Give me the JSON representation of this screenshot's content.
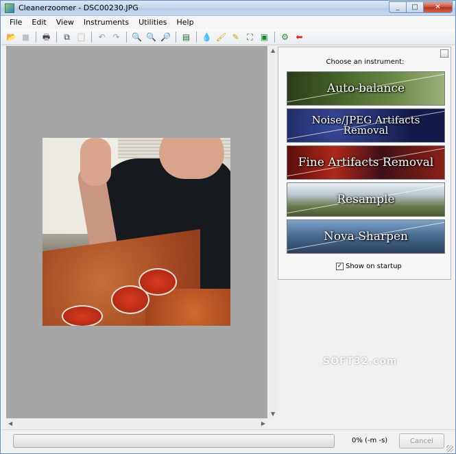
{
  "window": {
    "title": "Cleanerzoomer - DSC00230.JPG",
    "background_title": "",
    "controls": {
      "minimize": "_",
      "maximize": "□",
      "close": "✕"
    }
  },
  "menu": [
    "File",
    "Edit",
    "View",
    "Instruments",
    "Utilities",
    "Help"
  ],
  "toolbar": [
    {
      "name": "open-icon",
      "glyph": "📂"
    },
    {
      "name": "save-icon",
      "glyph": "■",
      "disabled": true
    },
    {
      "name": "print-icon",
      "glyph": "🖶"
    },
    {
      "name": "copy-icon",
      "glyph": "⧉"
    },
    {
      "name": "paste-icon",
      "glyph": "📋",
      "disabled": true
    },
    {
      "name": "undo-icon",
      "glyph": "↶",
      "disabled": true
    },
    {
      "name": "redo-icon",
      "glyph": "↷",
      "disabled": true
    },
    {
      "name": "zoom-in-icon",
      "glyph": "🔍"
    },
    {
      "name": "zoom-out-icon",
      "glyph": "🔍"
    },
    {
      "name": "zoom-actual-icon",
      "glyph": "🔎"
    },
    {
      "name": "filmstrip-icon",
      "glyph": "▤"
    },
    {
      "name": "droplet-icon",
      "glyph": "💧"
    },
    {
      "name": "broom-icon",
      "glyph": "🖌"
    },
    {
      "name": "magic-brush-icon",
      "glyph": "✎"
    },
    {
      "name": "fit-window-icon",
      "glyph": "⛶"
    },
    {
      "name": "image-icon",
      "glyph": "▣"
    },
    {
      "name": "settings-icon",
      "glyph": "⚙"
    },
    {
      "name": "back-red-icon",
      "glyph": "⬅"
    }
  ],
  "panel": {
    "heading": "Choose an instrument:",
    "instruments": [
      "Auto-balance",
      "Noise/JPEG Artifacts Removal",
      "Fine Artifacts Removal",
      "Resample",
      "Nova Sharpen"
    ],
    "show_on_startup": "Show on startup"
  },
  "watermark": "SOFT32.com",
  "status": {
    "progress_text": "0% (-m -s)",
    "progress": 0,
    "cancel_label": "Cancel"
  },
  "colors": {
    "canvas": "#a5a5a5",
    "title_gradient": "#c4d6ec",
    "close_button": "#c9503a"
  }
}
